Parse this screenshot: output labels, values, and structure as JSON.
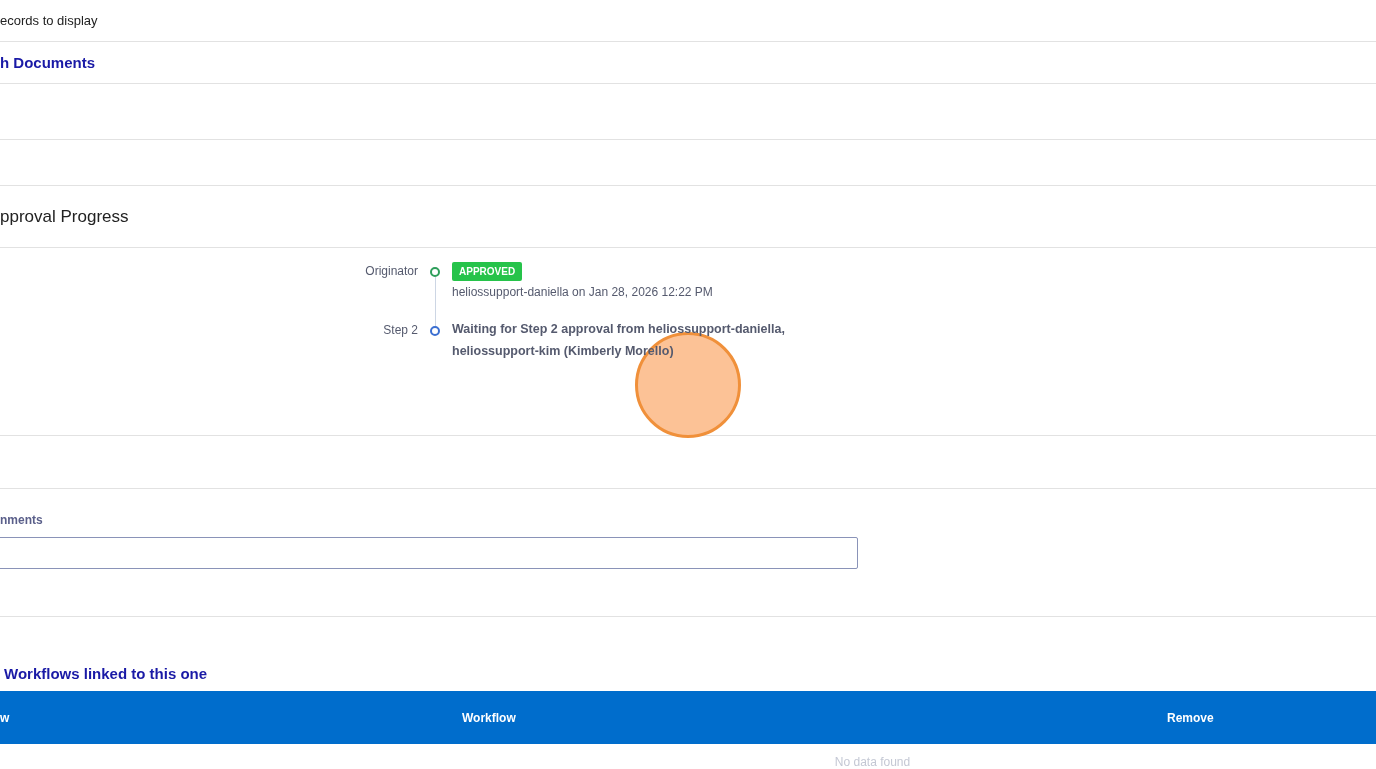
{
  "records_message": "ecords to display",
  "documents_title": "h Documents",
  "approval": {
    "title": "pproval Progress",
    "steps": [
      {
        "label": "Originator",
        "approved": true,
        "badge": "APPROVED",
        "detail": "heliossupport-daniella on Jan 28, 2026 12:22 PM"
      },
      {
        "label": "Step 2",
        "approved": false,
        "detail": "Waiting for Step 2 approval from heliossupport-daniella, heliossupport-kim (Kimberly Morello)"
      }
    ]
  },
  "comments": {
    "label": "nments"
  },
  "linked": {
    "title": "Workflows linked to this one",
    "columns": [
      "w",
      "Workflow",
      "Remove"
    ],
    "empty_message": "No data found"
  }
}
